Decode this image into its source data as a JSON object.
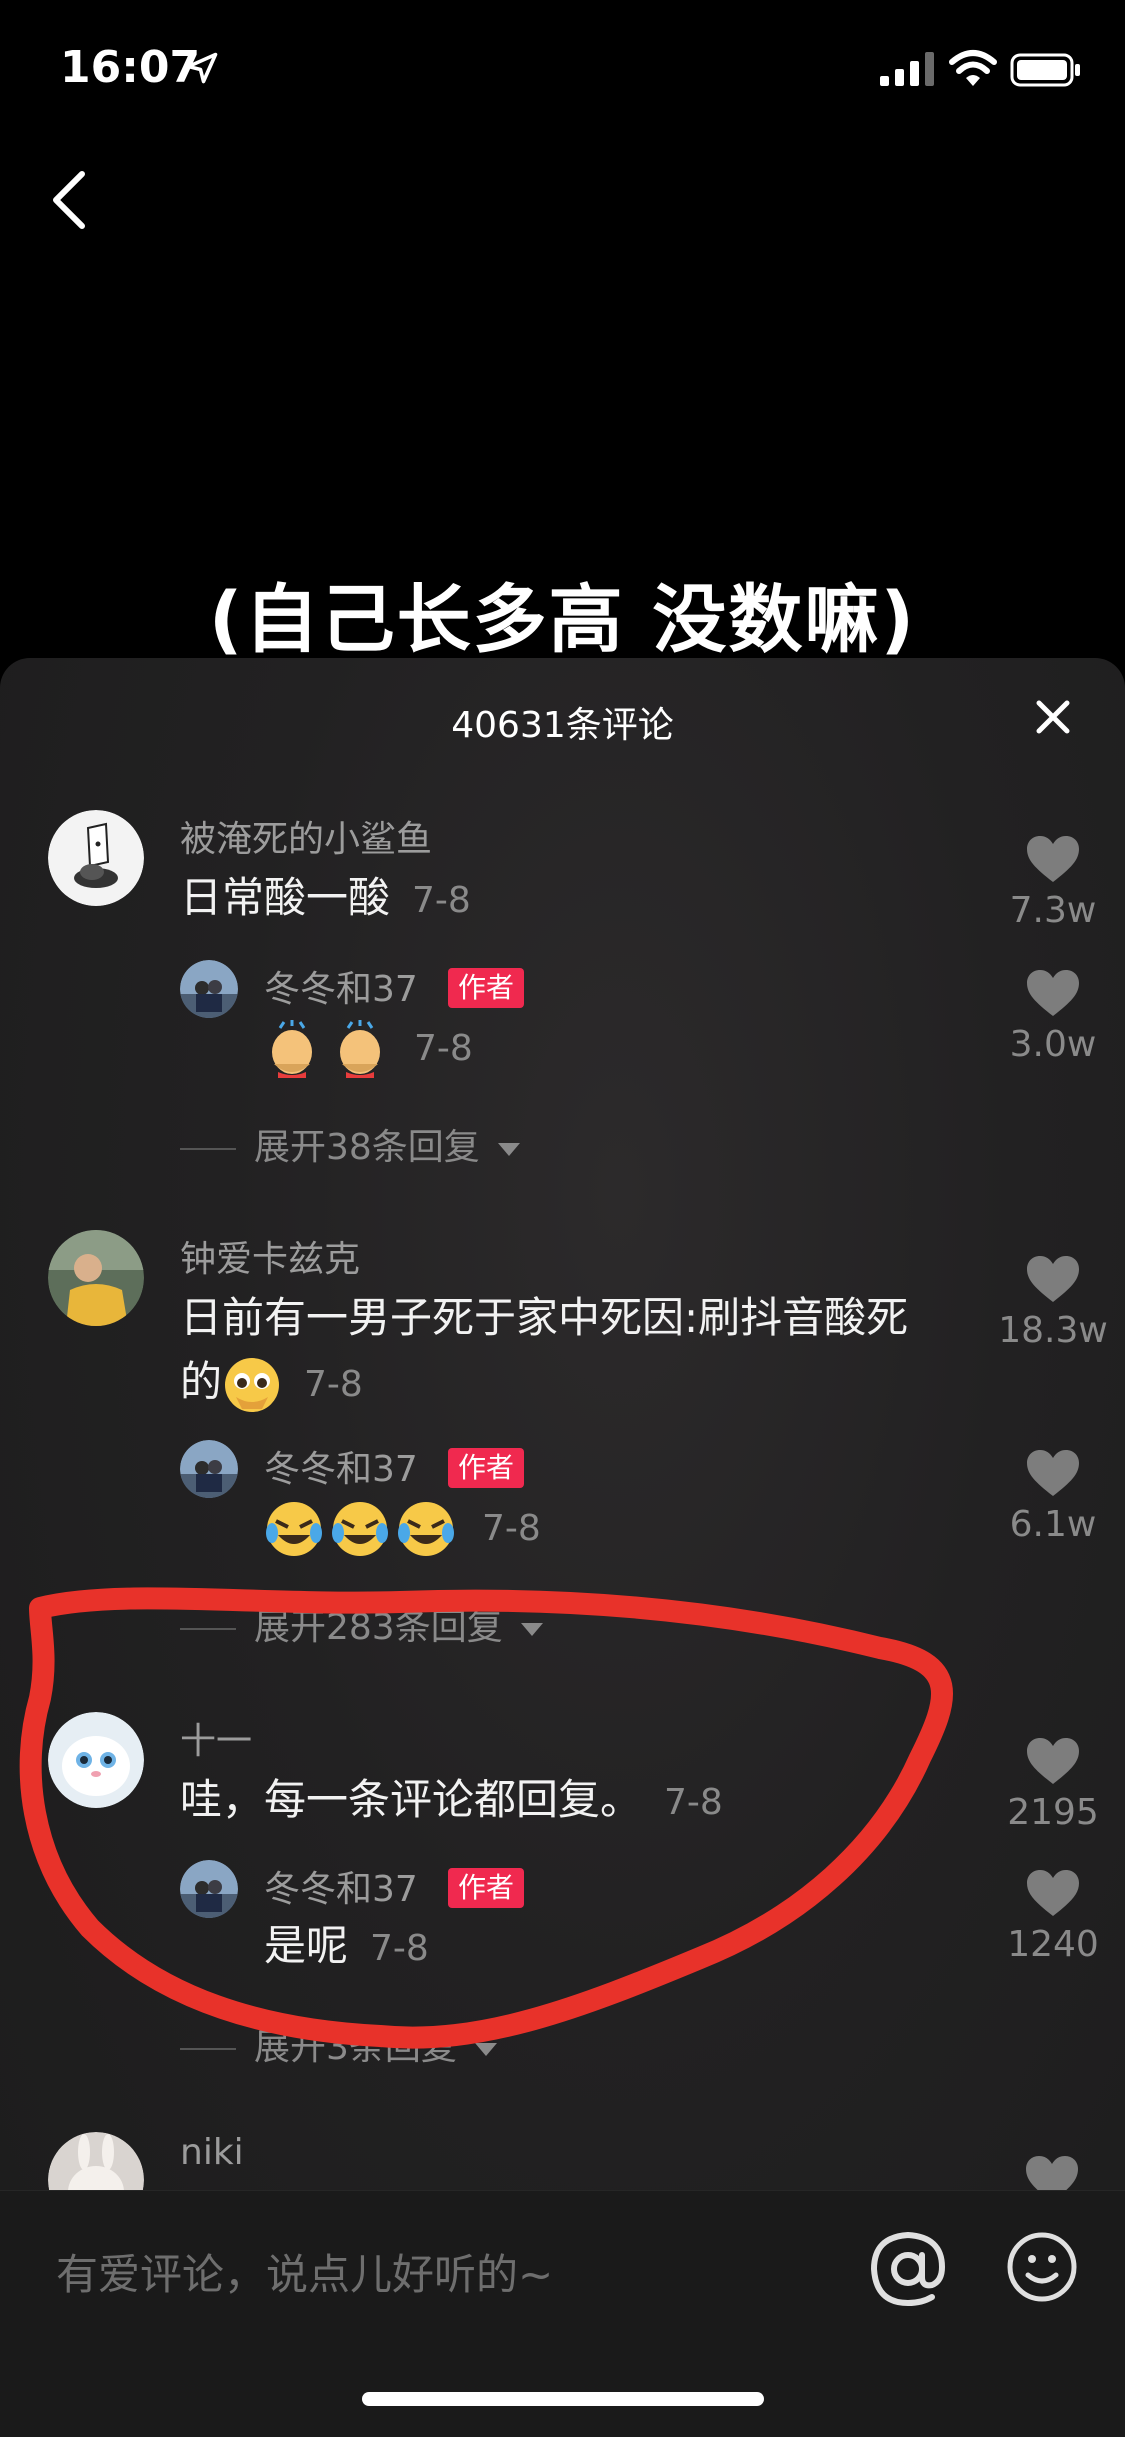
{
  "status_bar": {
    "time": "16:07"
  },
  "video": {
    "caption": "(自己长多高 没数嘛)"
  },
  "sheet": {
    "title": "40631条评论"
  },
  "comments": [
    {
      "username": "被淹死的小鲨鱼",
      "text": "日常酸一酸",
      "date": "7-8",
      "likes": "7.3w",
      "reply": {
        "username": "冬冬和37",
        "badge": "作者",
        "date": "7-8",
        "likes": "3.0w"
      },
      "expand": "展开38条回复"
    },
    {
      "username": "钟爱卡兹克",
      "text_line1": "日前有一男子死于家中死因:刷抖音酸死",
      "text_line2": "的",
      "date": "7-8",
      "likes": "18.3w",
      "reply": {
        "username": "冬冬和37",
        "badge": "作者",
        "date": "7-8",
        "likes": "6.1w"
      },
      "expand": "展开283条回复"
    },
    {
      "username": "十一",
      "text": "哇，每一条评论都回复。",
      "date": "7-8",
      "likes": "2195",
      "reply": {
        "username": "冬冬和37",
        "badge": "作者",
        "text": "是呢",
        "date": "7-8",
        "likes": "1240"
      },
      "expand": "展开3条回复"
    },
    {
      "username": "niki"
    }
  ],
  "input": {
    "placeholder": "有爱评论，说点儿好听的~"
  },
  "colors": {
    "author_badge": "#f0294f",
    "annotation": "#e8322a",
    "sheet_bg": "#222122"
  }
}
